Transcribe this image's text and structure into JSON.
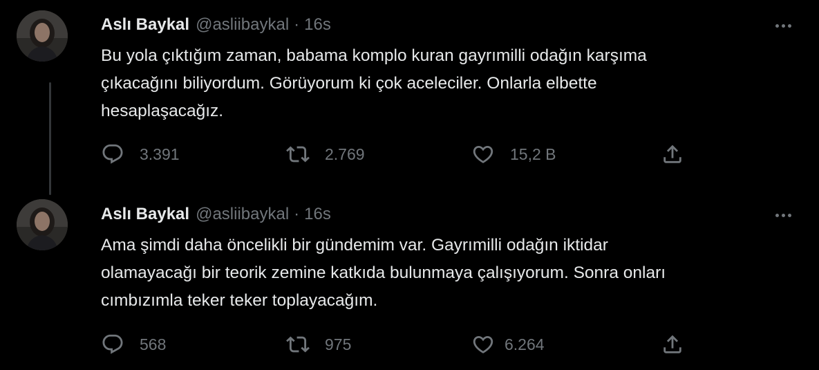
{
  "tweets": [
    {
      "author_name": "Aslı Baykal",
      "author_handle": "@asliibaykal",
      "separator": "·",
      "time": "16s",
      "text_lines": [
        "Bu yola çıktığım zaman, babama komplo kuran gayrımilli odağın karşıma",
        "çıkacağını biliyordum. Görüyorum ki çok aceleciler. Onlarla elbette",
        "hesaplaşacağız."
      ],
      "reply_count": "3.391",
      "retweet_count": "2.769",
      "like_count": "15,2 B"
    },
    {
      "author_name": "Aslı Baykal",
      "author_handle": "@asliibaykal",
      "separator": "·",
      "time": "16s",
      "text_lines": [
        "Ama şimdi daha öncelikli bir gündemim var. Gayrımilli odağın iktidar",
        "olamayacağı bir teorik zemine katkıda bulunmaya çalışıyorum. Sonra onları",
        "cımbızımla teker teker toplayacağım."
      ],
      "reply_count": "568",
      "retweet_count": "975",
      "like_count": "6.264"
    }
  ],
  "icons": {
    "reply": "reply-icon",
    "retweet": "retweet-icon",
    "like": "heart-icon",
    "share": "share-icon",
    "more": "more-options-icon"
  },
  "colors": {
    "background": "#000000",
    "text_primary": "#e7e9ea",
    "text_secondary": "#71767b",
    "thread_line": "#333639"
  }
}
